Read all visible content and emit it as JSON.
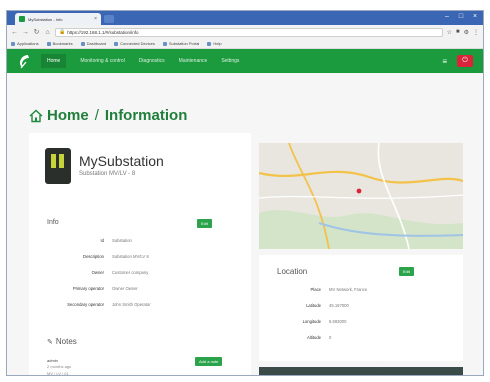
{
  "browser": {
    "tab_title": "MySubstation - Info",
    "url": "https://192.168.1.1/#/substation/info",
    "bookmarks": [
      "Applications",
      "Bookmarks",
      "Dashboard",
      "Connected Devices",
      "Substation Portal",
      "Help"
    ]
  },
  "nav": {
    "items": [
      "Home",
      "Monitoring & control",
      "Diagnostics",
      "Maintenance",
      "Settings"
    ]
  },
  "page": {
    "home": "Home",
    "separator": "/",
    "section": "Information"
  },
  "device": {
    "name": "MySubstation",
    "subtitle": "Substation MV/LV - 8"
  },
  "info": {
    "heading": "Info",
    "edit_label": "Edit",
    "fields": [
      {
        "key": "Id",
        "value": "Substation"
      },
      {
        "key": "Description",
        "value": "Substation MV/LV 8"
      },
      {
        "key": "Owner",
        "value": "Customer company"
      },
      {
        "key": "Primary operator",
        "value": "Owner Owner"
      },
      {
        "key": "Secondary operator",
        "value": "John Smith Operator"
      }
    ]
  },
  "notes": {
    "heading": "Notes",
    "add_label": "Add a note",
    "entry_title": "admin",
    "entry_time": "2 months ago",
    "entry_text": "MV / LV / 01"
  },
  "location": {
    "heading": "Location",
    "edit_label": "Edit",
    "fields": [
      {
        "key": "Place",
        "value": "MV Network, France"
      },
      {
        "key": "Latitude",
        "value": "45.167000"
      },
      {
        "key": "Longitude",
        "value": "5.693000"
      },
      {
        "key": "Altitude",
        "value": "0"
      }
    ]
  },
  "colors": {
    "brand_green": "#1c9a3e",
    "button_green": "#2aa34a",
    "logout_red": "#d9243a"
  }
}
